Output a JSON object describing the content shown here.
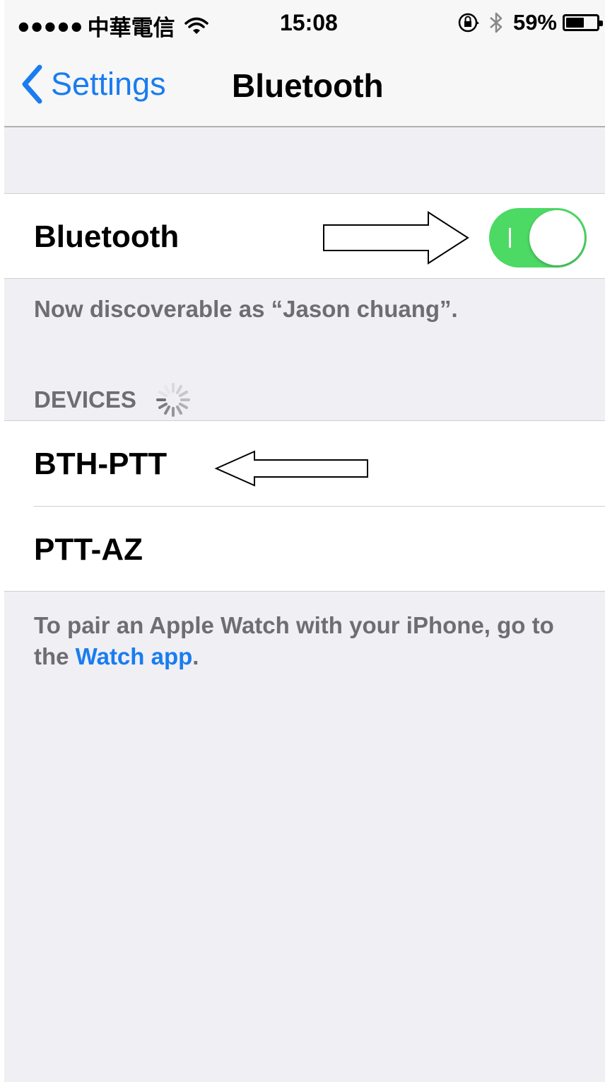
{
  "status_bar": {
    "signal_dots": "●●●●●",
    "carrier": "中華電信",
    "wifi_icon": "wifi-icon",
    "time": "15:08",
    "orientation_lock_icon": "orientation-lock-icon",
    "bluetooth_icon": "bluetooth-icon",
    "battery_percent": "59%",
    "battery_level": 0.59
  },
  "nav": {
    "back_label": "Settings",
    "title": "Bluetooth"
  },
  "bluetooth": {
    "label": "Bluetooth",
    "enabled": true,
    "toggle_on_mark": "I",
    "accent_color": "#4cd964"
  },
  "notes": {
    "discoverable": "Now discoverable as “Jason chuang”.",
    "watch_prefix": "To pair an Apple Watch with your iPhone, go to the ",
    "watch_link": "Watch app",
    "watch_suffix": "."
  },
  "devices": {
    "header": "DEVICES",
    "items": [
      {
        "name": "BTH-PTT"
      },
      {
        "name": "PTT-AZ"
      }
    ]
  },
  "colors": {
    "link_blue": "#1a7cf0",
    "background": "#efeff4"
  }
}
